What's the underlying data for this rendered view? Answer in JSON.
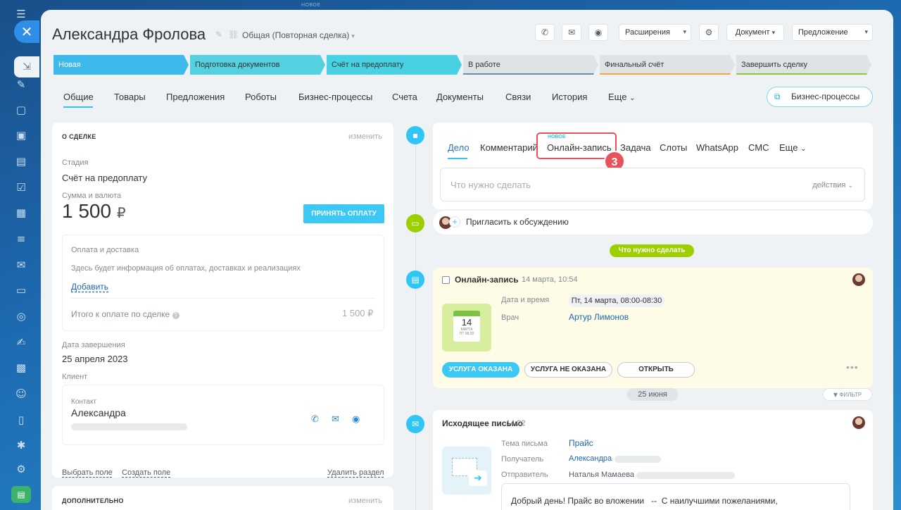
{
  "top_tag": "НОВОЕ",
  "rail": {
    "icons": [
      "menu-icon",
      "tasks-icon",
      "chat-icon",
      "calendar-icon",
      "document-icon",
      "checklist-icon",
      "calendar-grid-icon",
      "filter-icon",
      "mail-icon",
      "storage-icon",
      "target-icon",
      "signature-icon",
      "id-card-icon",
      "contacts-icon",
      "file-icon",
      "bug-icon",
      "settings-icon"
    ]
  },
  "header": {
    "title": "Александра Фролова",
    "funnel": "Общая (Повторная сделка)",
    "buttons": {
      "extensions": "Расширения",
      "document": "Документ",
      "proposal": "Предложение"
    }
  },
  "stages": [
    {
      "label": "Новая",
      "color": "#3db9ec"
    },
    {
      "label": "Подготовка документов",
      "color": "#55d0e0"
    },
    {
      "label": "Счёт на предоплату",
      "color": "#47d1e2"
    },
    {
      "label": "В работе",
      "color": "#e0e3e6"
    },
    {
      "label": "Финальный счёт",
      "color": "#e0e3e6"
    },
    {
      "label": "Завершить сделку",
      "color": "#e0e3e6"
    }
  ],
  "tabs": [
    "Общие",
    "Товары",
    "Предложения",
    "Роботы",
    "Бизнес-процессы",
    "Счета",
    "Документы",
    "Связи",
    "История",
    "Еще"
  ],
  "bp_button": "Бизнес-процессы",
  "deal": {
    "section_title": "О СДЕЛКЕ",
    "edit": "изменить",
    "stage_label": "Стадия",
    "stage_value": "Счёт на предоплату",
    "amount_label": "Сумма и валюта",
    "amount_value": "1 500",
    "currency": "₽",
    "pay_button": "ПРИНЯТЬ ОПЛАТУ",
    "payment_title": "Оплата и доставка",
    "payment_text": "Здесь будет информация об оплатах, доставках и реализациях",
    "add_link": "Добавить",
    "total_label": "Итого к оплате по сделке",
    "total_value": "1 500 ₽",
    "close_label": "Дата завершения",
    "close_value": "25 апреля 2023",
    "client_label": "Клиент",
    "contact_label": "Контакт",
    "contact_name": "Александра",
    "select_field": "Выбрать поле",
    "create_field": "Создать поле",
    "delete_section": "Удалить раздел"
  },
  "additional": {
    "section_title": "ДОПОЛНИТЕЛЬНО",
    "edit": "изменить"
  },
  "activity": {
    "tabs": [
      "Дело",
      "Комментарий",
      "Онлайн-запись",
      "Задача",
      "Слоты",
      "WhatsApp",
      "СМС",
      "Еще"
    ],
    "new_tag": "НОВОЕ",
    "step_badge": "3",
    "input_placeholder": "Что нужно сделать",
    "actions": "действия",
    "invite": "Пригласить к обсуждению",
    "todo_pill": "Что нужно сделать",
    "booking": {
      "title": "Онлайн-запись",
      "time": "14 марта, 10:54",
      "cal_day": "14",
      "cal_month": "МАРТА",
      "cal_time": "ПТ 08:00",
      "date_label": "Дата и время",
      "date_value": "Пт, 14 марта, 08:00-08:30",
      "doctor_label": "Врач",
      "doctor_value": "Артур Лимонов",
      "btn_done": "УСЛУГА ОКАЗАНА",
      "btn_not_done": "УСЛУГА НЕ ОКАЗАНА",
      "btn_open": "ОТКРЫТЬ"
    },
    "date_pill": "25 июня",
    "filter": "ФИЛЬТР",
    "email": {
      "title": "Исходящее письмо",
      "time": "14:22",
      "subject_label": "Тема письма",
      "subject_value": "Прайс",
      "recipient_label": "Получатель",
      "recipient_value": "Александра",
      "sender_label": "Отправитель",
      "sender_value": "Наталья Мамаева",
      "body": "Добрый день! Прайс во вложении   --  С наилучшими пожеланиями,"
    }
  }
}
